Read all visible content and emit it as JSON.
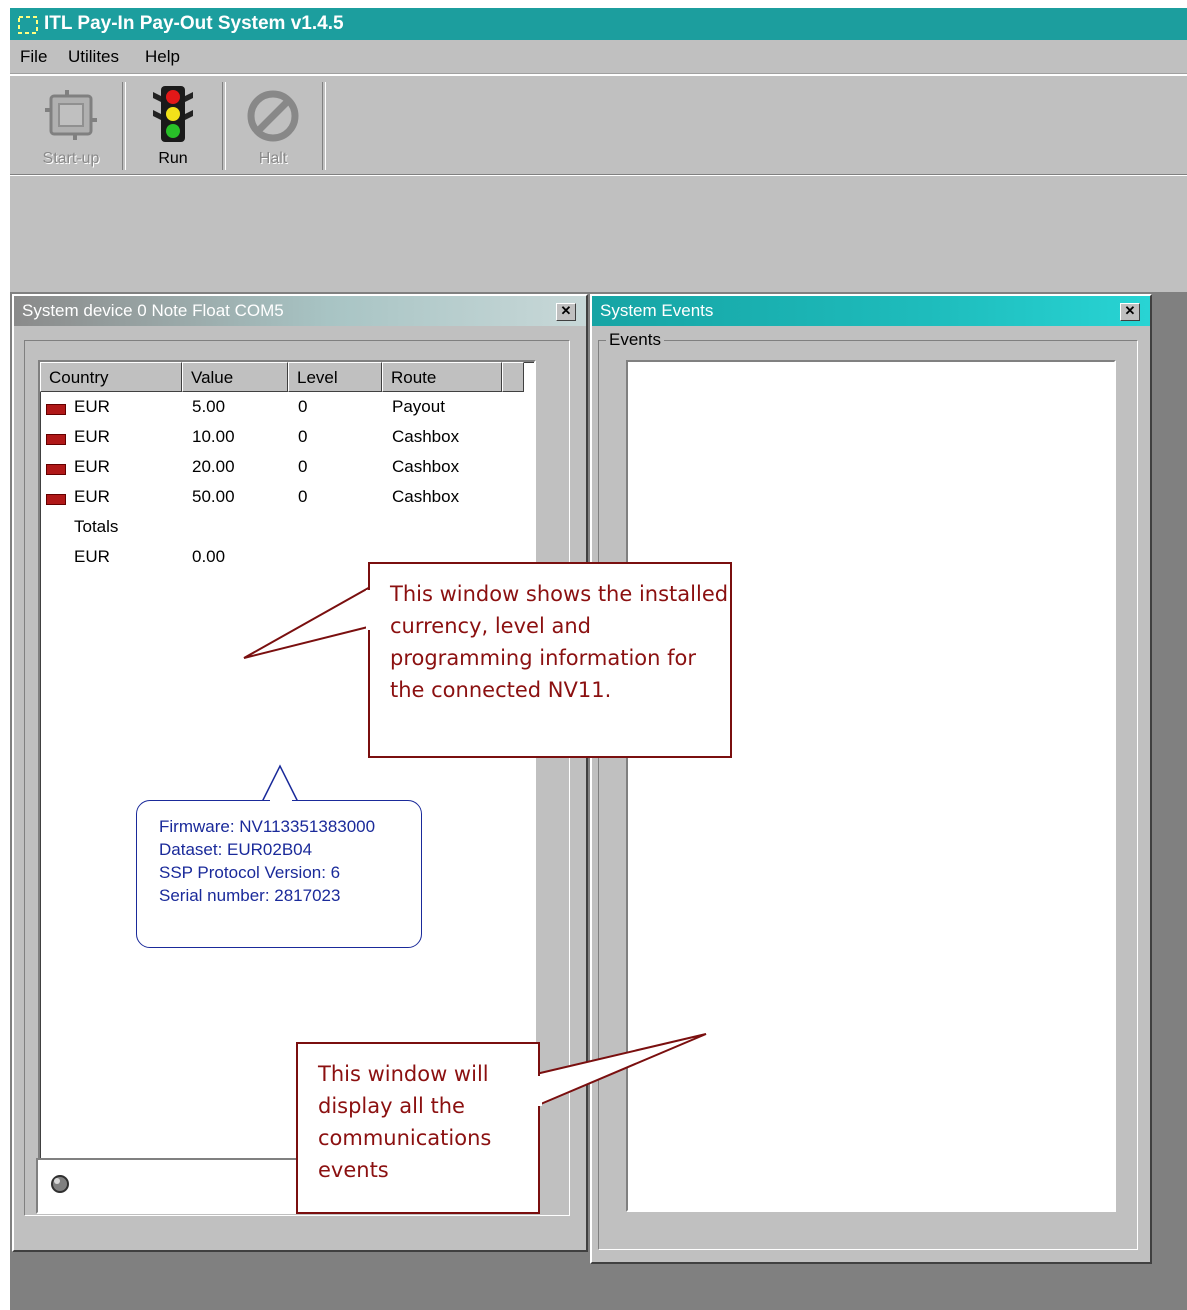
{
  "window": {
    "title": "ITL Pay-In Pay-Out System  v1.4.5"
  },
  "menu": [
    "File",
    "Utilites",
    "Help"
  ],
  "toolbar": {
    "startup": {
      "label": "Start-up",
      "enabled": false,
      "icon": "startup-icon"
    },
    "run": {
      "label": "Run",
      "enabled": true,
      "icon": "traffic-light-icon"
    },
    "halt": {
      "label": "Halt",
      "enabled": false,
      "icon": "halt-icon"
    }
  },
  "device_window": {
    "title": "System device 0 Note Float COM5",
    "columns": [
      "Country",
      "Value",
      "Level",
      "Route"
    ],
    "rows": [
      {
        "country": "EUR",
        "value": "5.00",
        "level": "0",
        "route": "Payout"
      },
      {
        "country": "EUR",
        "value": "10.00",
        "level": "0",
        "route": "Cashbox"
      },
      {
        "country": "EUR",
        "value": "20.00",
        "level": "0",
        "route": "Cashbox"
      },
      {
        "country": "EUR",
        "value": "50.00",
        "level": "0",
        "route": "Cashbox"
      }
    ],
    "totals_label": "Totals",
    "totals": {
      "country": "EUR",
      "value": "0.00"
    },
    "info": {
      "firmware": "Firmware: NV113351383000",
      "dataset": "Dataset: EUR02B04",
      "protocol": "SSP Protocol Version: 6",
      "serial": "Serial number: 2817023"
    }
  },
  "events_window": {
    "title": "System Events",
    "group_label": "Events"
  },
  "callouts": {
    "device": "This window shows the installed currency, level and programming information for the connected NV11.",
    "events": "This window will display all the communications events"
  },
  "colors": {
    "titlebar": "#1c9e9e",
    "callout": "#7a0f0f",
    "bubble": "#1a2a9a",
    "flag": "#b01818"
  }
}
